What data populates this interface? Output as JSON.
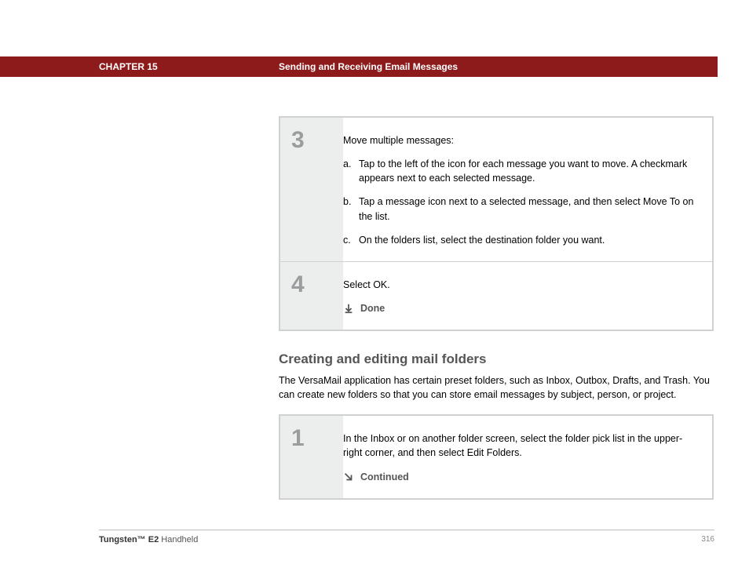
{
  "header": {
    "chapter": "CHAPTER 15",
    "title": "Sending and Receiving Email Messages"
  },
  "steps_a": [
    {
      "num": "3",
      "intro": "Move multiple messages:",
      "subs": [
        {
          "letter": "a.",
          "text": "Tap to the left of the icon for each message you want to move. A checkmark appears next to each selected message."
        },
        {
          "letter": "b.",
          "text": "Tap a message icon next to a selected message, and then select Move To on the list."
        },
        {
          "letter": "c.",
          "text": "On the folders list, select the destination folder you want."
        }
      ]
    },
    {
      "num": "4",
      "text": "Select OK.",
      "done": "Done"
    }
  ],
  "section": {
    "heading": "Creating and editing mail folders",
    "para": "The VersaMail application has certain preset folders, such as Inbox, Outbox, Drafts, and Trash. You can create new folders so that you can store email messages by subject, person, or project."
  },
  "steps_b": [
    {
      "num": "1",
      "text": "In the Inbox or on another folder screen, select the folder pick list in the upper-right corner, and then select Edit Folders.",
      "continued": "Continued"
    }
  ],
  "footer": {
    "product_bold": "Tungsten™ E2",
    "product_rest": " Handheld",
    "page": "316"
  }
}
